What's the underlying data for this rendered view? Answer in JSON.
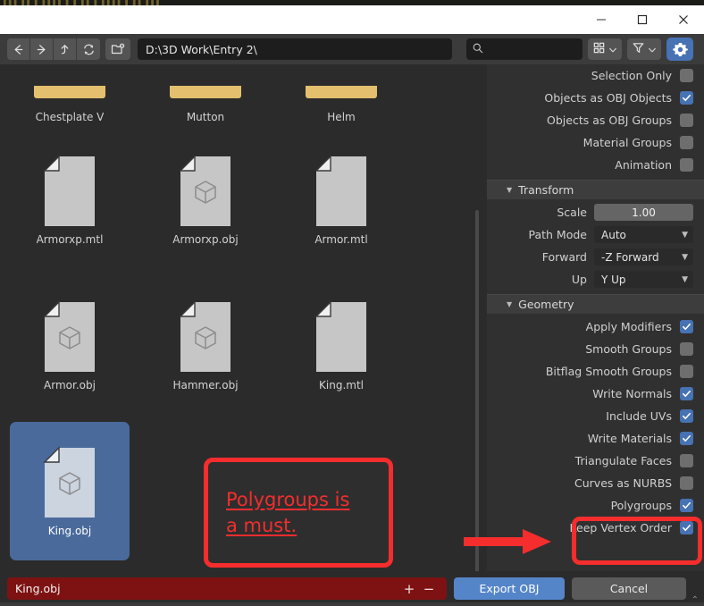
{
  "window": {
    "ghost_text": "  ▌▌▌ ▌▌ ▌ ▌▌▌▌ ▌  ▌ ▌▌  ▌ ▌▌▌▌  ▌ ▌▌ ▌▌▌",
    "controls": {
      "minimize": "minimize-icon",
      "maximize": "maximize-icon",
      "close": "close-icon"
    }
  },
  "toolbar": {
    "back_icon": "arrow-left-icon",
    "forward_icon": "arrow-right-icon",
    "up_icon": "arrow-up-icon",
    "refresh_icon": "refresh-icon",
    "new_folder_icon": "new-folder-icon",
    "path_value": "D:\\3D Work\\Entry 2\\",
    "path_placeholder": "",
    "search_value": "",
    "search_placeholder": "",
    "display_mode_icon": "grid-view-icon",
    "filter_icon": "filter-funnel-icon",
    "settings_icon": "gear-icon",
    "accent_color": "#4772b3"
  },
  "filebrowser": {
    "items": [
      {
        "name": "Chestplate V",
        "kind": "folder",
        "selected": false,
        "cut_off": true
      },
      {
        "name": "Mutton",
        "kind": "folder",
        "selected": false,
        "cut_off": true
      },
      {
        "name": "Helm",
        "kind": "folder",
        "selected": false,
        "cut_off": true
      },
      {
        "name": "Armorxp.mtl",
        "kind": "file",
        "selected": false,
        "cut_off": false
      },
      {
        "name": "Armorxp.obj",
        "kind": "model",
        "selected": false,
        "cut_off": false
      },
      {
        "name": "Armor.mtl",
        "kind": "file",
        "selected": false,
        "cut_off": false
      },
      {
        "name": "Armor.obj",
        "kind": "model",
        "selected": false,
        "cut_off": false
      },
      {
        "name": "Hammer.obj",
        "kind": "model",
        "selected": false,
        "cut_off": false
      },
      {
        "name": "King.mtl",
        "kind": "file",
        "selected": false,
        "cut_off": false
      },
      {
        "name": "King.obj",
        "kind": "model",
        "selected": true,
        "cut_off": false
      }
    ],
    "selection_color": "#4a6a9c",
    "folder_color": "#e3bf6e"
  },
  "properties": {
    "top_options": [
      {
        "label": "Selection Only",
        "checked": false
      },
      {
        "label": "Objects as OBJ Objects",
        "checked": true
      },
      {
        "label": "Objects as OBJ Groups",
        "checked": false
      },
      {
        "label": "Material Groups",
        "checked": false
      },
      {
        "label": "Animation",
        "checked": false
      }
    ],
    "transform": {
      "title": "Transform",
      "scale_label": "Scale",
      "scale_value": "1.00",
      "path_mode_label": "Path Mode",
      "path_mode_value": "Auto",
      "forward_label": "Forward",
      "forward_value": "-Z Forward",
      "up_label": "Up",
      "up_value": "Y Up"
    },
    "geometry": {
      "title": "Geometry",
      "options": [
        {
          "label": "Apply Modifiers",
          "checked": true
        },
        {
          "label": "Smooth Groups",
          "checked": false
        },
        {
          "label": "Bitflag Smooth Groups",
          "checked": false
        },
        {
          "label": "Write Normals",
          "checked": true
        },
        {
          "label": "Include UVs",
          "checked": true
        },
        {
          "label": "Write Materials",
          "checked": true
        },
        {
          "label": "Triangulate Faces",
          "checked": false
        },
        {
          "label": "Curves as NURBS",
          "checked": false
        },
        {
          "label": "Polygroups",
          "checked": true
        },
        {
          "label": "Keep Vertex Order",
          "checked": true
        }
      ]
    }
  },
  "footer": {
    "filename_value": "King.obj",
    "filename_placeholder": "",
    "increment_label": "+",
    "decrement_label": "−",
    "export_label": "Export OBJ",
    "cancel_label": "Cancel",
    "caret_label": "⌃"
  },
  "annotation": {
    "line1": "Polygroups is",
    "line2": "a must.",
    "color": "#f52d2d"
  }
}
